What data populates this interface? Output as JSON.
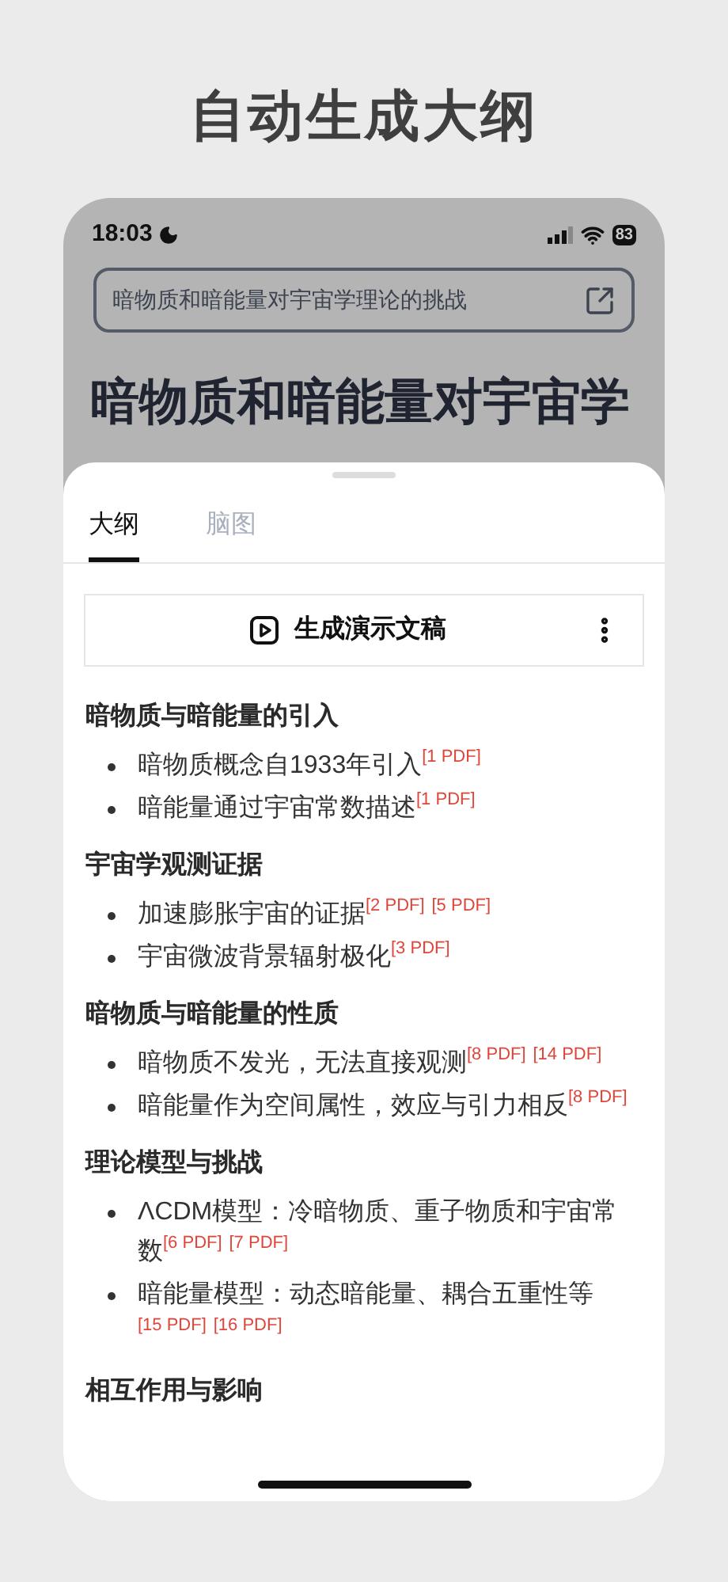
{
  "page_title": "自动生成大纲",
  "status_bar": {
    "time": "18:03",
    "battery": "83"
  },
  "address_field": {
    "value": "暗物质和暗能量对宇宙学理论的挑战"
  },
  "article_title": "暗物质和暗能量对宇宙学",
  "tabs": [
    {
      "label": "大纲",
      "selected": true
    },
    {
      "label": "脑图",
      "selected": false
    }
  ],
  "action_button": {
    "label": "生成演示文稿"
  },
  "outline": [
    {
      "heading": "暗物质与暗能量的引入",
      "items": [
        {
          "text": "暗物质概念自1933年引入",
          "refs": [
            "[1 PDF]"
          ]
        },
        {
          "text": "暗能量通过宇宙常数描述",
          "refs": [
            "[1 PDF]"
          ]
        }
      ]
    },
    {
      "heading": "宇宙学观测证据",
      "items": [
        {
          "text": "加速膨胀宇宙的证据",
          "refs": [
            "[2 PDF]",
            "[5 PDF]"
          ]
        },
        {
          "text": "宇宙微波背景辐射极化",
          "refs": [
            "[3 PDF]"
          ]
        }
      ]
    },
    {
      "heading": "暗物质与暗能量的性质",
      "items": [
        {
          "text": "暗物质不发光，无法直接观测",
          "refs": [
            "[8 PDF]",
            "[14 PDF]"
          ]
        },
        {
          "text": "暗能量作为空间属性，效应与引力相反",
          "refs": [
            "[8 PDF]"
          ]
        }
      ]
    },
    {
      "heading": "理论模型与挑战",
      "items": [
        {
          "text": "ΛCDM模型：冷暗物质、重子物质和宇宙常数",
          "refs": [
            "[6 PDF]",
            "[7 PDF]"
          ]
        },
        {
          "text": "暗能量模型：动态暗能量、耦合五重性等",
          "refs": [
            "[15 PDF]",
            "[16 PDF]"
          ]
        }
      ]
    },
    {
      "heading": "相互作用与影响"
    }
  ]
}
